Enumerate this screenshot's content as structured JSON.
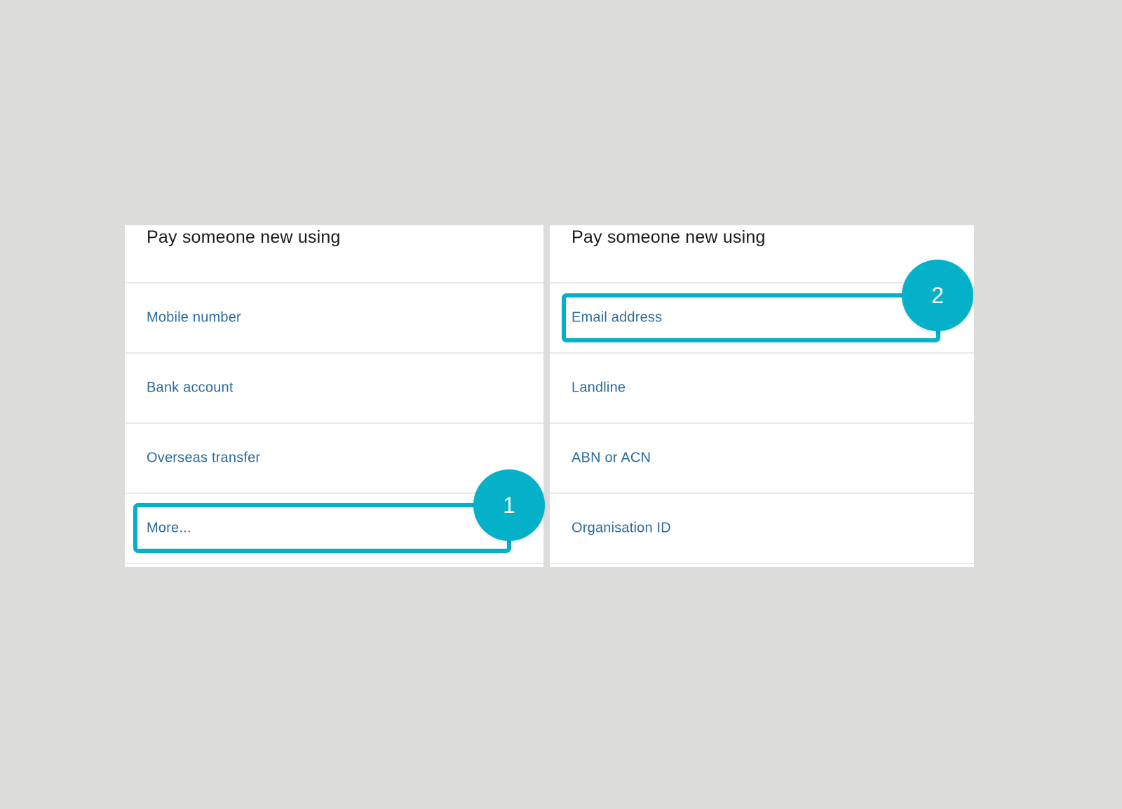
{
  "panels": [
    {
      "title": "Pay someone new using",
      "options": [
        {
          "label": "Mobile number"
        },
        {
          "label": "Bank account"
        },
        {
          "label": "Overseas transfer"
        },
        {
          "label": "More..."
        }
      ]
    },
    {
      "title": "Pay someone new using",
      "options": [
        {
          "label": "Email address"
        },
        {
          "label": "Landline"
        },
        {
          "label": "ABN or ACN"
        },
        {
          "label": "Organisation ID"
        }
      ]
    }
  ],
  "annotations": [
    {
      "step": "1",
      "target": "More..."
    },
    {
      "step": "2",
      "target": "Email address"
    }
  ],
  "colors": {
    "background": "#dcdcda",
    "panel": "#ffffff",
    "link_text": "#2c6a9c",
    "title_text": "#1c1c1c",
    "accent": "#05b1c8",
    "divider": "#e8e8e8"
  }
}
